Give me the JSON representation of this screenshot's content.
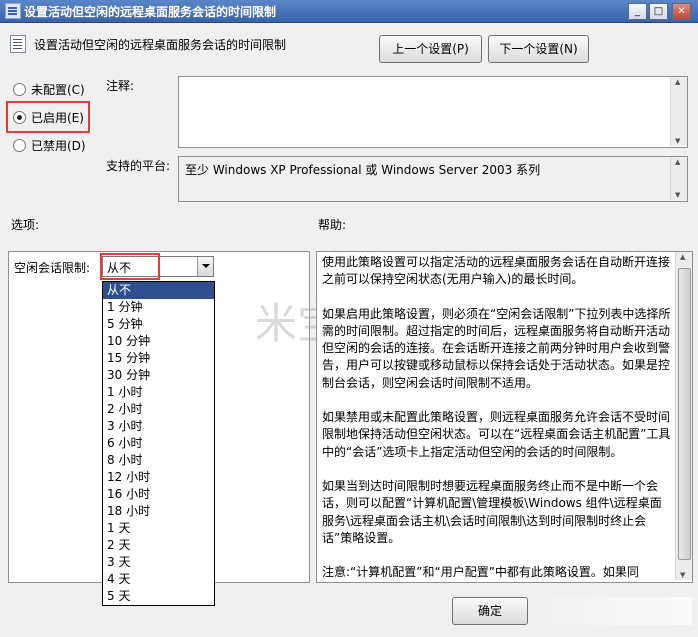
{
  "window": {
    "title": "设置活动但空闲的远程桌面服务会话的时间限制",
    "minimize": "_",
    "maximize": "□",
    "close": "✕"
  },
  "header": {
    "title": "设置活动但空闲的远程桌面服务会话的时间限制",
    "prev_button": "上一个设置(P)",
    "next_button": "下一个设置(N)"
  },
  "state": {
    "not_configured": "未配置(C)",
    "enabled": "已启用(E)",
    "disabled": "已禁用(D)",
    "selected": "enabled"
  },
  "comment": {
    "label": "注释:",
    "value": ""
  },
  "platform": {
    "label": "支持的平台:",
    "value": "至少 Windows XP Professional 或 Windows Server 2003 系列"
  },
  "options": {
    "label": "选项:",
    "idle_limit_label": "空闲会话限制:",
    "selected_value": "从不",
    "dropdown_items": [
      "从不",
      "1 分钟",
      "5 分钟",
      "10 分钟",
      "15 分钟",
      "30 分钟",
      "1 小时",
      "2 小时",
      "3 小时",
      "6 小时",
      "8 小时",
      "12 小时",
      "16 小时",
      "18 小时",
      "1 天",
      "2 天",
      "3 天",
      "4 天",
      "5 天"
    ]
  },
  "help": {
    "label": "帮助:",
    "paragraphs": [
      "使用此策略设置可以指定活动的远程桌面服务会话在自动断开连接之前可以保持空闲状态(无用户输入)的最长时间。",
      "如果启用此策略设置，则必须在“空闲会话限制”下拉列表中选择所需的时间限制。超过指定的时间后，远程桌面服务将自动断开活动但空闲的会话的连接。在会话断开连接之前两分钟时用户会收到警告，用户可以按键或移动鼠标以保持会话处于活动状态。如果是控制台会话，则空闲会话时间限制不适用。",
      "如果禁用或未配置此策略设置，则远程桌面服务允许会话不受时间限制地保持活动但空闲状态。可以在“远程桌面会话主机配置”工具中的“会话”选项卡上指定活动但空闲的会话的时间限制。",
      "如果当到达时间限制时想要远程桌面服务终止而不是中断一个会话，则可以配置“计算机配置\\管理模板\\Windows 组件\\远程桌面服务\\远程桌面会话主机\\会话时间限制\\达到时间限制时终止会话”策略设置。",
      "注意:“计算机配置”和“用户配置”中都有此策略设置。如果同"
    ]
  },
  "footer": {
    "ok_button": "确定"
  },
  "watermark": "米宝网络"
}
